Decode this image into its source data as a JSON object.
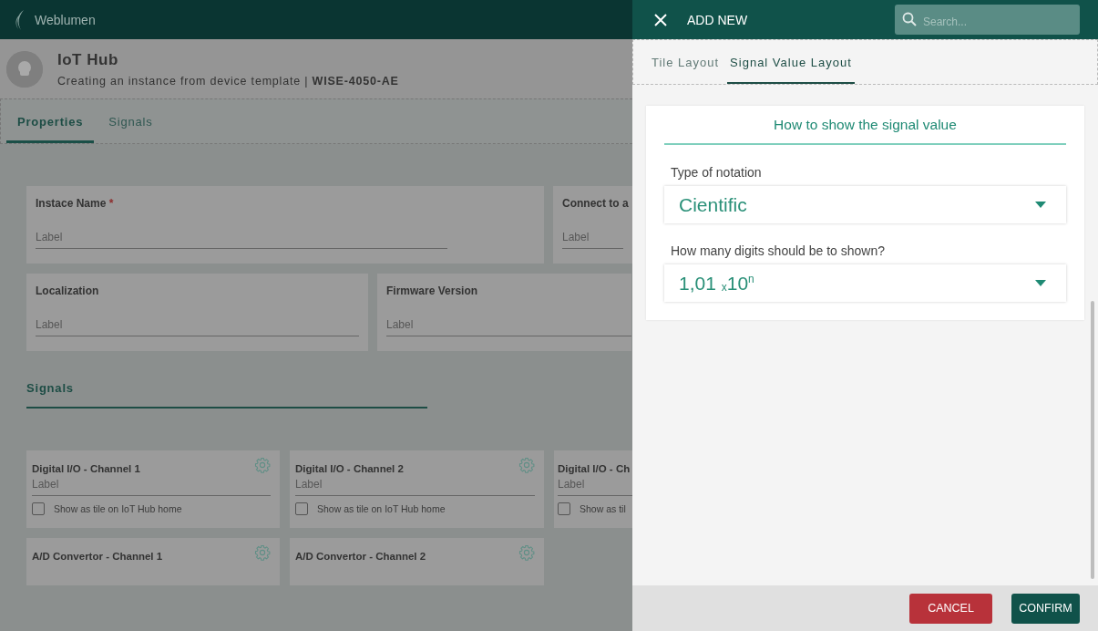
{
  "app": {
    "brand": "Weblumen",
    "header": {
      "title": "IoT Hub",
      "subtitle": "Creating an instance from device template | **WISE-4050-AE**"
    },
    "tabs": [
      {
        "label": "Properties",
        "selected": true
      },
      {
        "label": "Signals",
        "selected": false
      }
    ],
    "fields": [
      {
        "label": "Instace Name",
        "required_mark": "*",
        "placeholder": "Label"
      },
      {
        "label": "Connect to a",
        "placeholder": "Label"
      },
      {
        "label": "Localization",
        "placeholder": "Label"
      },
      {
        "label": "Firmware Version",
        "placeholder": "Label"
      }
    ],
    "signals_heading": "Signals",
    "signals": [
      {
        "title": "Digital I/O - Channel 1",
        "placeholder": "Label",
        "checkbox_label": "Show as tile on IoT Hub home",
        "checked": false
      },
      {
        "title": "Digital I/O - Channel 2",
        "placeholder": "Label",
        "checkbox_label": "Show as tile on IoT Hub home",
        "checked": false
      },
      {
        "title": "Digital I/O - Ch",
        "placeholder": "Label",
        "checkbox_label": "Show as til",
        "checked": false
      },
      {
        "title": "A/D Convertor - Channel 1"
      },
      {
        "title": "A/D Convertor - Channel 2"
      }
    ]
  },
  "drawer": {
    "title": "ADD NEW",
    "search": {
      "placeholder": "Search..."
    },
    "tabs": [
      {
        "label": "Tile Layout",
        "selected": false
      },
      {
        "label": "Signal Value Layout",
        "selected": true
      }
    ],
    "card": {
      "heading": "How to show the signal value",
      "fields": [
        {
          "label": "Type of notation",
          "value": "Cientific"
        },
        {
          "label": "How many digits should be to shown?",
          "value": "1,01 $_{x}$10$^{n}$"
        }
      ]
    },
    "buttons": [
      {
        "label": "CANCEL",
        "kind": "cancel"
      },
      {
        "label": "CONFIRM",
        "kind": "confirm"
      }
    ]
  }
}
